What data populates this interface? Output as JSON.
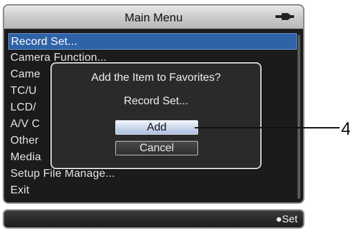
{
  "screen": {
    "title": "Main Menu",
    "battery_icon": "battery-plug-icon"
  },
  "menu": {
    "items": [
      {
        "label": "Record Set...",
        "selected": true
      },
      {
        "label": "Camera Function..."
      },
      {
        "label": "Came"
      },
      {
        "label": "TC/U"
      },
      {
        "label": "LCD/"
      },
      {
        "label": "A/V C"
      },
      {
        "label": "Other"
      },
      {
        "label": "Media"
      },
      {
        "label": "Setup File Manage..."
      },
      {
        "label": "Exit"
      }
    ]
  },
  "dialog": {
    "title": "Add the Item to Favorites?",
    "item": "Record Set...",
    "add_label": "Add",
    "cancel_label": "Cancel"
  },
  "status": {
    "set_label": "●Set"
  },
  "callout": {
    "number": "4"
  },
  "colors": {
    "selection": "#2f63a8",
    "screen_bg": "#1b1b1b"
  }
}
